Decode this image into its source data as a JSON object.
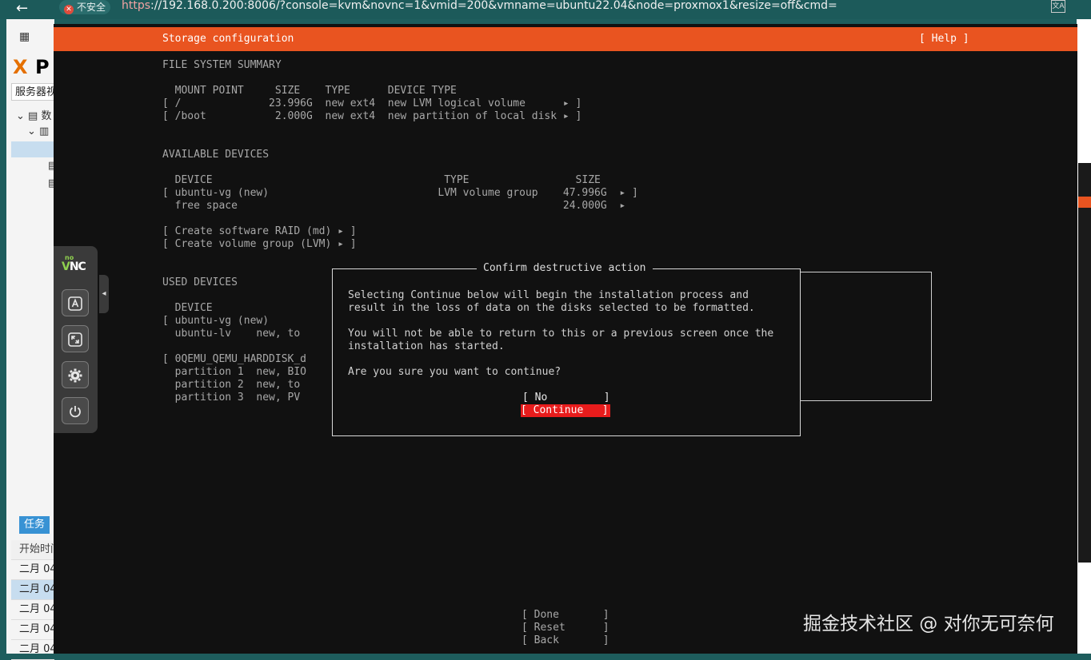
{
  "browser": {
    "back_glyph": "←",
    "security_label": "不安全",
    "url_scheme": "https",
    "url_rest": "://192.168.0.200:8006/?console=kvm&novnc=1&vmid=200&vmname=ubuntu22.04&node=proxmox1&resize=off&cmd="
  },
  "pve": {
    "logo_x": "X",
    "logo_p": "P",
    "server_view": "服务器视图",
    "tree_datacenter": "数",
    "task_tab": "任务",
    "task_header": "开始时间",
    "task_rows": [
      "二月 04",
      "二月 04",
      "二月 04",
      "二月 04",
      "二月 04"
    ]
  },
  "installer": {
    "header_title": "Storage configuration",
    "header_help": "[ Help ]",
    "fs_summary_heading": "FILE SYSTEM SUMMARY",
    "fs_table_header": "  MOUNT POINT     SIZE    TYPE      DEVICE TYPE",
    "fs_rows": [
      "[ /              23.996G  new ext4  new LVM logical volume      ▸ ]",
      "[ /boot           2.000G  new ext4  new partition of local disk ▸ ]"
    ],
    "avail_heading": "AVAILABLE DEVICES",
    "avail_table_header": "  DEVICE                                     TYPE                 SIZE",
    "avail_rows": [
      "[ ubuntu-vg (new)                           LVM volume group    47.996G  ▸ ]",
      "  free space                                                    24.000G  ▸"
    ],
    "create_raid": "[ Create software RAID (md) ▸ ]",
    "create_vg": "[ Create volume group (LVM) ▸ ]",
    "used_heading": "USED DEVICES",
    "used_table_header": "  DEVICE",
    "used_rows": [
      "[ ubuntu-vg (new)",
      "  ubuntu-lv    new, to",
      "",
      "[ 0QEMU_QEMU_HARDDISK_d",
      "  partition 1  new, BIO",
      "  partition 2  new, to",
      "  partition 3  new, PV"
    ],
    "done_btn": "[ Done       ]",
    "reset_btn": "[ Reset      ]",
    "back_btn": "[ Back       ]"
  },
  "dialog": {
    "title": "Confirm destructive action",
    "line1": "Selecting Continue below will begin the installation process and",
    "line2": "result in the loss of data on the disks selected to be formatted.",
    "line3": "You will not be able to return to this or a previous screen once the",
    "line4": "installation has started.",
    "line5": "Are you sure you want to continue?",
    "no_btn": "[ No         ]",
    "continue_btn": "[ Continue   ]"
  },
  "vnc": {
    "logo_no": "no",
    "logo_v": "V",
    "logo_nc": "NC",
    "icons": [
      "keyboard-icon",
      "fullscreen-icon",
      "gear-icon",
      "power-icon"
    ],
    "handle_glyph": "◂"
  },
  "watermark": "掘金技术社区 @ 对你无可奈何",
  "colors": {
    "header_orange": "#e95420",
    "continue_red": "#e81c1c",
    "console_bg": "#111111",
    "browser_bar": "#1c5a5a"
  }
}
